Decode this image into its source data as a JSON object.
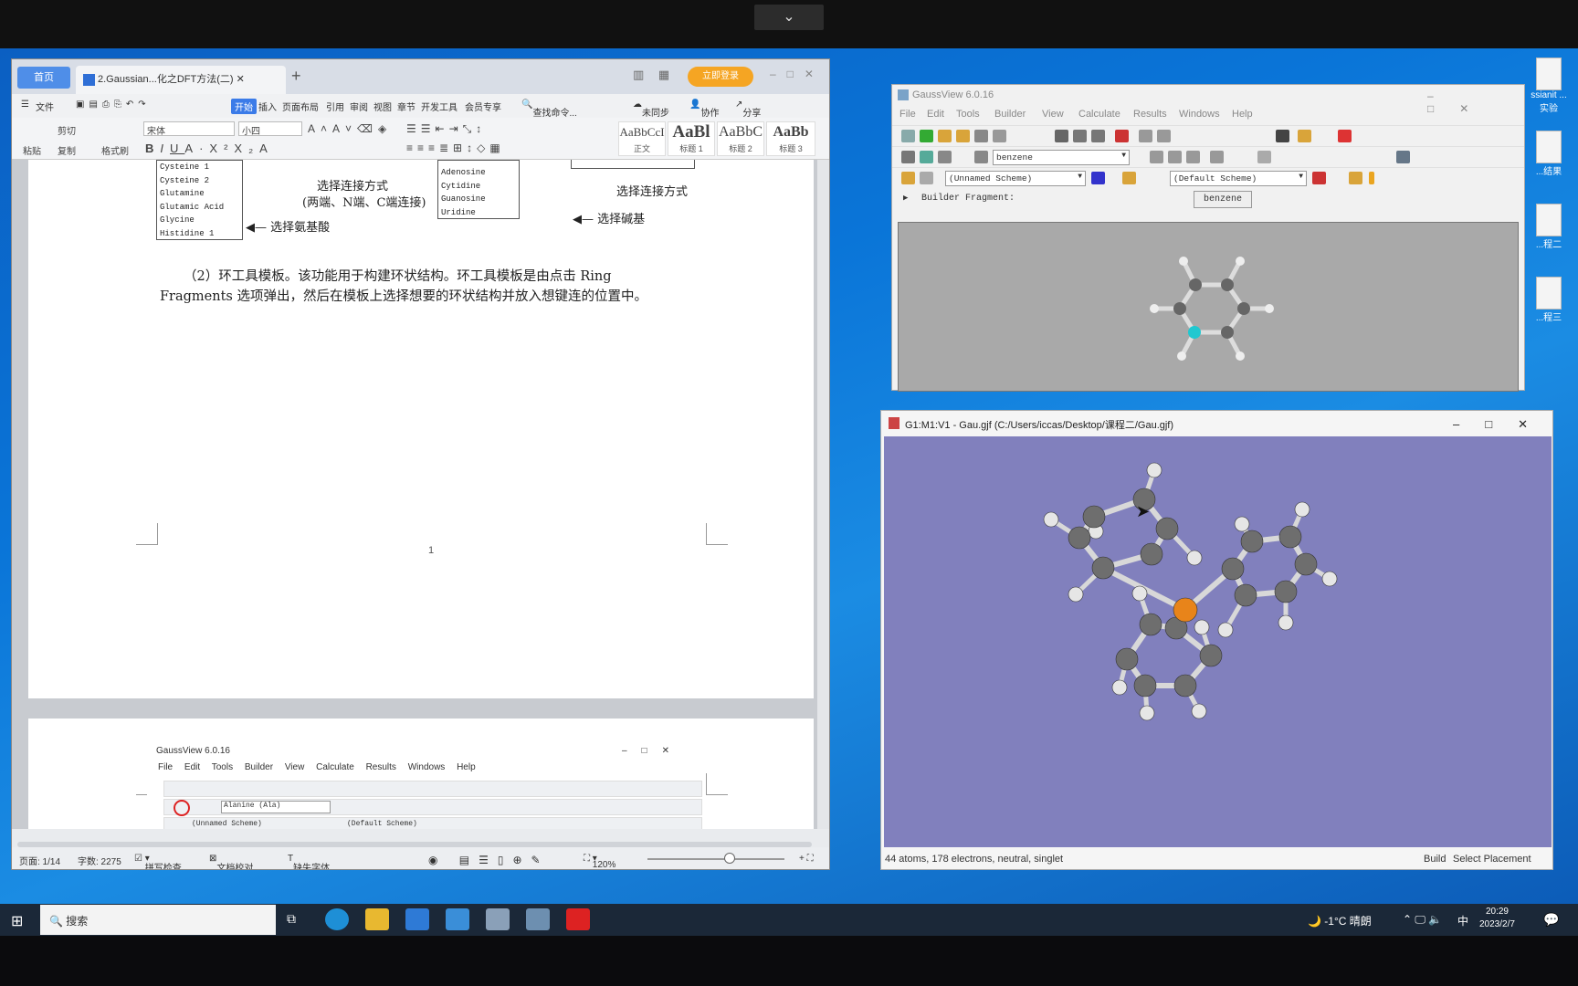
{
  "wps": {
    "home_tab": "首页",
    "doc_tab": "2.Gaussian...化之DFT方法(二)",
    "login_button": "立即登录",
    "menu": [
      "文件",
      "开始",
      "插入",
      "页面布局",
      "引用",
      "审阅",
      "视图",
      "章节",
      "开发工具",
      "会员专享"
    ],
    "search_cmd": "查找命令...",
    "sync": "未同步",
    "collab": "协作",
    "share": "分享",
    "ribbon": {
      "cut": "剪切",
      "copy": "复制",
      "paste": "粘贴",
      "format_painter": "格式刷",
      "font": "宋体",
      "size": "小四",
      "styles": [
        {
          "sample": "AaBbCcI",
          "name": "正文"
        },
        {
          "sample": "AaBl",
          "name": "标题 1"
        },
        {
          "sample": "AaBbC",
          "name": "标题 2"
        },
        {
          "sample": "AaBb",
          "name": "标题 3"
        }
      ]
    },
    "doc": {
      "amino_list": [
        "Cysteine 1",
        "Cysteine 2",
        "Glutamine",
        "Glutamic Acid",
        "Glycine",
        "Histidine 1"
      ],
      "base_list": [
        "Adenosine",
        "Cytidine",
        "Guanosine",
        "Uridine"
      ],
      "cap_connect": "选择连接方式",
      "cap_ends": "(两端、N端、C端连接)",
      "cap_connect2": "选择连接方式",
      "cap_amino": "选择氨基酸",
      "cap_base": "选择碱基",
      "para_line1": "（2）环工具模板。该功能用于构建环状结构。环工具模板是由点击 Ring",
      "para_line2": "Fragments 选项弹出，然后在模板上选择想要的环状结构并放入想键连的位置中。",
      "page_num": "1",
      "mini_gv": {
        "title": "GaussView 6.0.16",
        "menu": [
          "File",
          "Edit",
          "Tools",
          "Builder",
          "View",
          "Calculate",
          "Results",
          "Windows",
          "Help"
        ],
        "combo": "Alanine (Ala)",
        "scheme": "(Unnamed Scheme)",
        "default_scheme": "(Default Scheme)"
      }
    },
    "status": {
      "page": "页面: 1/14",
      "words": "字数: 2275",
      "spell": "拼写检查",
      "proof": "文档校对",
      "missing_font": "缺失字体",
      "zoom": "120%"
    }
  },
  "gv_builder": {
    "title": "GaussView 6.0.16",
    "menu": [
      "File",
      "Edit",
      "Tools",
      "Builder",
      "View",
      "Calculate",
      "Results",
      "Windows",
      "Help"
    ],
    "fragment_combo": "benzene",
    "scheme": "(Unnamed Scheme)",
    "default_scheme": "(Default Scheme)",
    "builder_label": "Builder Fragment:",
    "fragment_button": "benzene"
  },
  "gv_molecule": {
    "title": "G1:M1:V1 - Gau.gjf (C:/Users/iccas/Desktop/课程二/Gau.gjf)",
    "status_info": "44 atoms, 178 electrons, neutral, singlet",
    "status_mode": "Build",
    "status_action": "Select Placement"
  },
  "desktop_icons": [
    "ssianit\n...实验",
    "...结果",
    "...程二",
    "...程三"
  ],
  "taskbar": {
    "search": "搜索",
    "weather": "-1°C 晴朗",
    "ime": "中",
    "time": "20:29",
    "date": "2023/2/7"
  },
  "colors": {
    "desktop": "#0a75d8",
    "wps_accent": "#3b7be8",
    "viewport_bg": "#8180bd",
    "phosphorus": "#e8841a",
    "carbon": "#6e6e6e",
    "hydrogen": "#e6e6e6",
    "selected_atom": "#20c8d0"
  }
}
